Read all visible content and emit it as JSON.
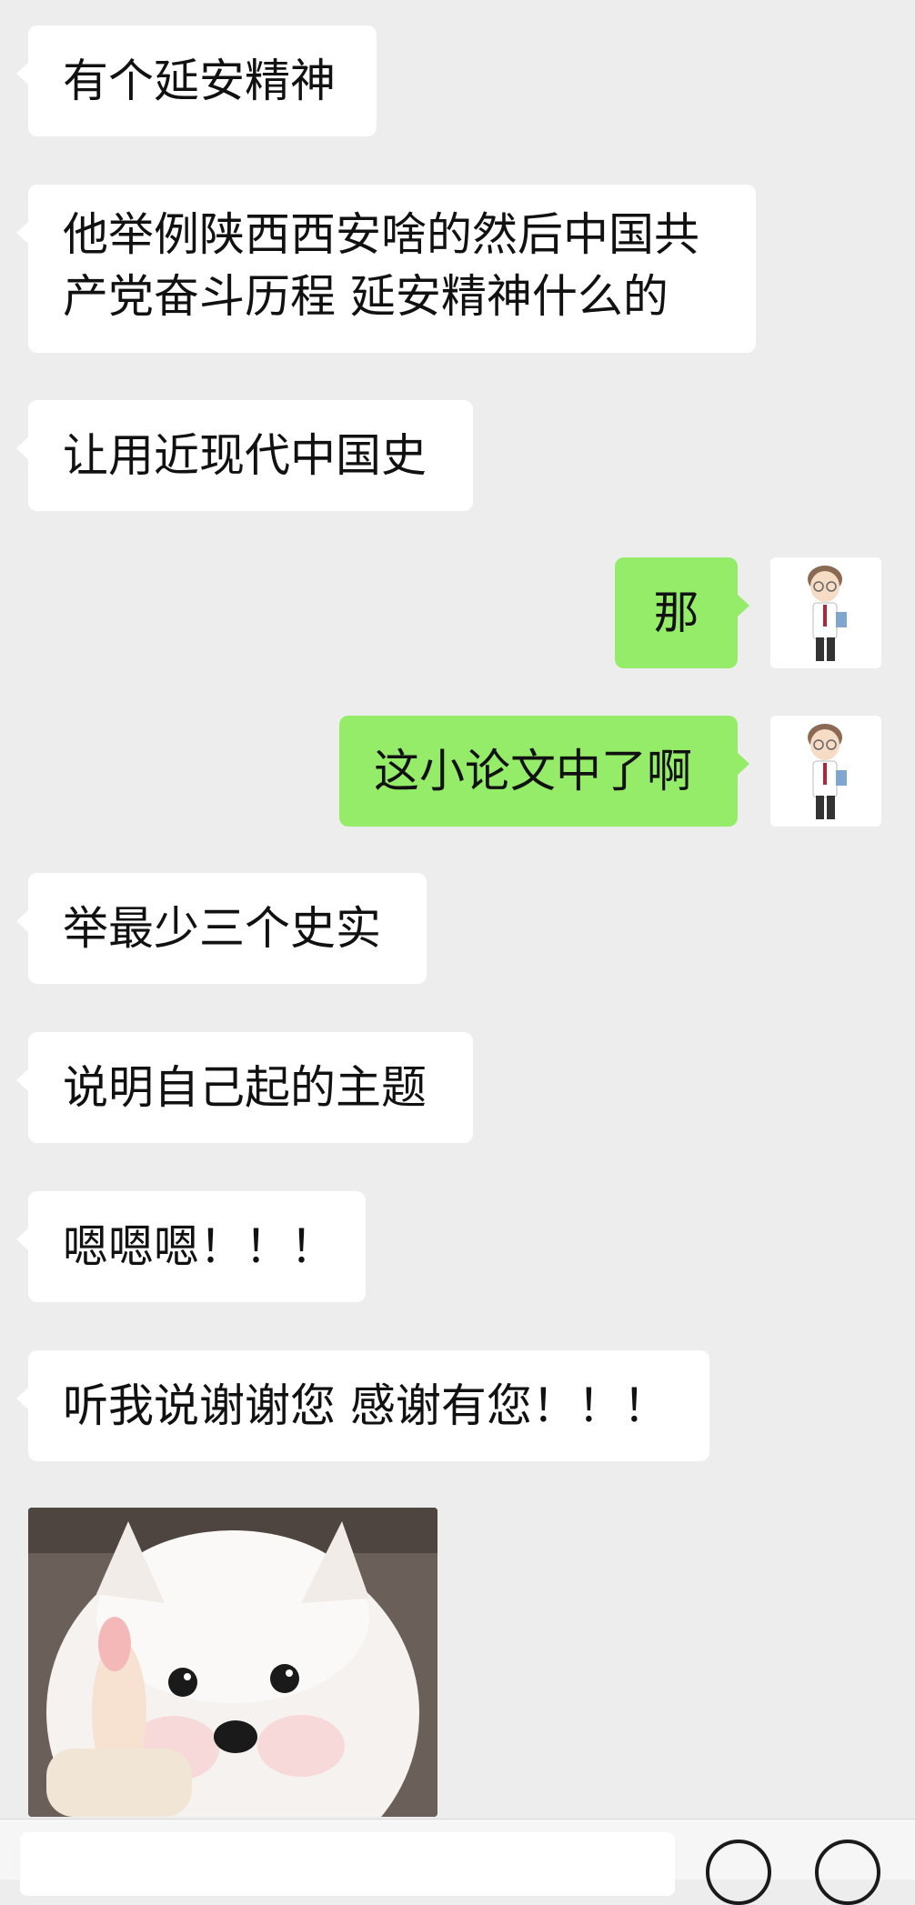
{
  "messages": [
    {
      "side": "in",
      "text": "有个延安精神"
    },
    {
      "side": "in",
      "text": "他举例陕西西安啥的然后中国共产党奋斗历程 延安精神什么的"
    },
    {
      "side": "in",
      "text": "让用近现代中国史"
    },
    {
      "side": "out",
      "text": "那"
    },
    {
      "side": "out",
      "text": "这小论文中了啊"
    },
    {
      "side": "in",
      "text": "举最少三个史实"
    },
    {
      "side": "in",
      "text": "说明自己起的主题"
    },
    {
      "side": "in",
      "text": "嗯嗯嗯！！！"
    },
    {
      "side": "in",
      "text": "听我说谢谢您 感谢有您！！！"
    }
  ],
  "colors": {
    "background": "#ededed",
    "incoming_bubble": "#ffffff",
    "outgoing_bubble": "#95ec69"
  },
  "icons": {
    "avatar": "cartoon-man-avatar-icon",
    "sticker": "white-dog-thumbs-up-sticker",
    "emoji_button": "emoji-icon",
    "more_button": "plus-icon"
  }
}
